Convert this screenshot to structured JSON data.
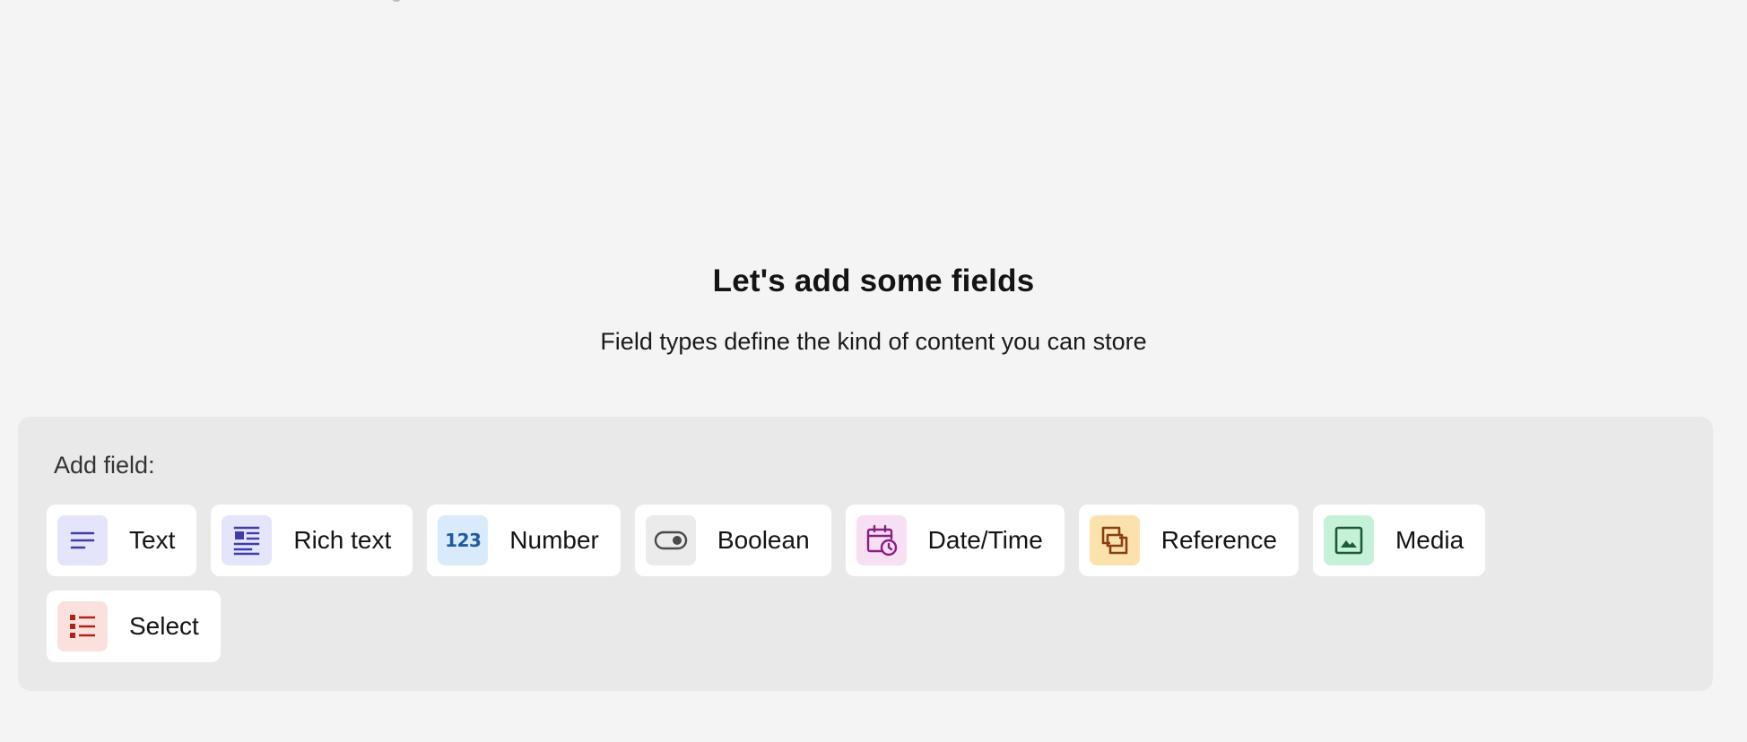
{
  "empty_state": {
    "title": "Let's add some fields",
    "subtitle": "Field types define the kind of content you can store"
  },
  "add_field": {
    "label": "Add field:",
    "types": [
      {
        "label": "Text",
        "icon": "text-lines-icon",
        "icon_bg": "#e4e4fb",
        "icon_color": "#3d3dab"
      },
      {
        "label": "Rich text",
        "icon": "rich-text-icon",
        "icon_bg": "#e4e4fb",
        "icon_color": "#3d3dab"
      },
      {
        "label": "Number",
        "icon": "number-123-icon",
        "icon_glyph": "123",
        "icon_bg": "#d9ebfb",
        "icon_color": "#1f5aa6"
      },
      {
        "label": "Boolean",
        "icon": "toggle-icon",
        "icon_bg": "#ebebeb",
        "icon_color": "#4a4a4a"
      },
      {
        "label": "Date/Time",
        "icon": "calendar-clock-icon",
        "icon_bg": "#f7dff4",
        "icon_color": "#8a1f82"
      },
      {
        "label": "Reference",
        "icon": "reference-link-icon",
        "icon_bg": "#fbe2ad",
        "icon_color": "#8a3f12"
      },
      {
        "label": "Media",
        "icon": "image-icon",
        "icon_bg": "#c5f1d9",
        "icon_color": "#1d5a3a"
      },
      {
        "label": "Select",
        "icon": "list-select-icon",
        "icon_bg": "#fbe1dd",
        "icon_color": "#b02418"
      }
    ]
  }
}
